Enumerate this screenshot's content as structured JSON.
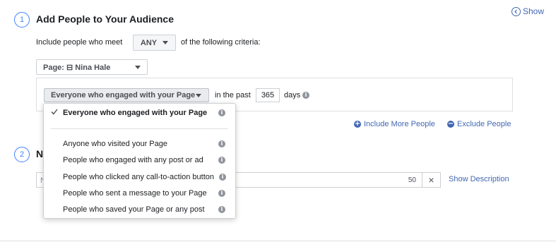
{
  "step1": {
    "number": "1",
    "title": "Add People to Your Audience",
    "show_label": "Show",
    "include_prefix": "Include people who meet",
    "match_mode": "ANY",
    "include_suffix": "of the following criteria:",
    "source_label": "Page: ⊟ Nina Hale",
    "engagement_selected": "Everyone who engaged with your Page",
    "in_the_past": "in the past",
    "days_value": "365",
    "days_label": "days",
    "include_more": "Include More People",
    "exclude_people": "Exclude People"
  },
  "step2": {
    "number": "2",
    "title_partial": "N",
    "name_placeholder": "N",
    "char_count": "50",
    "clear_symbol": "×",
    "show_description": "Show Description"
  },
  "dropdown": {
    "selected_item": "Everyone who engaged with your Page",
    "items": [
      "Anyone who visited your Page",
      "People who engaged with any post or ad",
      "People who clicked any call-to-action button",
      "People who sent a message to your Page",
      "People who saved your Page or any post"
    ]
  },
  "icons": {
    "info": "info-icon",
    "check": "check-icon",
    "plus": "plus-circle-icon",
    "minus": "minus-circle-icon",
    "show": "chevron-circle-icon"
  },
  "colors": {
    "accent": "#4267b2",
    "step_circle": "#4080ff",
    "border": "#ccd0d5",
    "info_grey": "#90949c"
  }
}
